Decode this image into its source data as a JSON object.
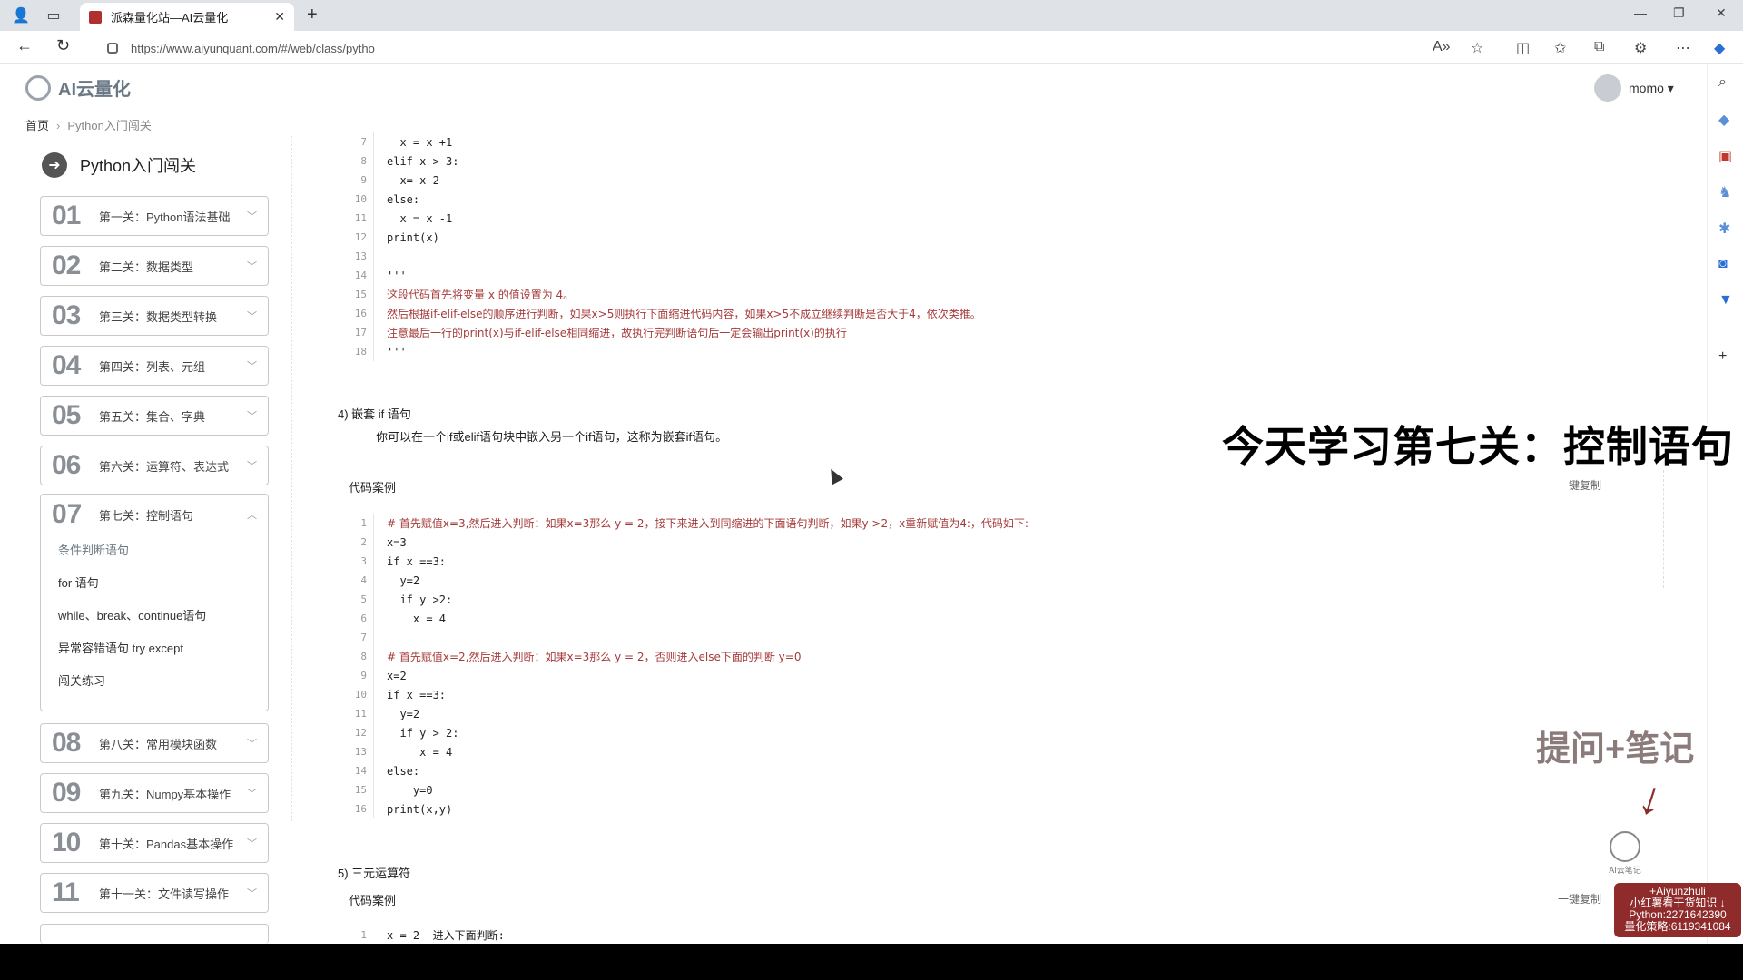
{
  "browser": {
    "tab_title": "派森量化站—AI云量化",
    "url": "https://www.aiyunquant.com/#/web/class/pytho",
    "colors": {
      "tabbar": "#dfe3e8",
      "accent": "#a63b3b"
    }
  },
  "site": {
    "logo_text": "AI云量化",
    "user_name": "momo ▾",
    "breadcrumb": {
      "home": "首页",
      "current": "Python入门闯关"
    }
  },
  "sidebar": {
    "course_title": "Python入门闯关",
    "lessons": [
      {
        "num": "01",
        "title": "第一关：Python语法基础"
      },
      {
        "num": "02",
        "title": "第二关：数据类型"
      },
      {
        "num": "03",
        "title": "第三关：数据类型转换"
      },
      {
        "num": "04",
        "title": "第四关：列表、元组"
      },
      {
        "num": "05",
        "title": "第五关：集合、字典"
      },
      {
        "num": "06",
        "title": "第六关：运算符、表达式"
      },
      {
        "num": "07",
        "title": "第七关：控制语句"
      },
      {
        "num": "08",
        "title": "第八关：常用模块函数"
      },
      {
        "num": "09",
        "title": "第九关：Numpy基本操作"
      },
      {
        "num": "10",
        "title": "第十关：Pandas基本操作"
      },
      {
        "num": "11",
        "title": "第十一关：文件读写操作"
      }
    ],
    "open_lesson_items": [
      "条件判断语句",
      "for 语句",
      "while、break、continue语句",
      "异常容错语句 try except",
      "闯关练习"
    ]
  },
  "main": {
    "code_top": [
      {
        "n": "7",
        "t": "  x = x +1"
      },
      {
        "n": "8",
        "t": "elif x > 3:"
      },
      {
        "n": "9",
        "t": "  x= x-2"
      },
      {
        "n": "10",
        "t": "else:"
      },
      {
        "n": "11",
        "t": "  x = x -1"
      },
      {
        "n": "12",
        "t": "print(x)"
      },
      {
        "n": "13",
        "t": ""
      },
      {
        "n": "14",
        "t": "'''"
      },
      {
        "n": "15",
        "t": "这段代码首先将变量 x 的值设置为 4。",
        "c": true
      },
      {
        "n": "16",
        "t": "然后根据if-elif-else的顺序进行判断，如果x>5则执行下面缩进代码内容，如果x>5不成立继续判断是否大于4，依次类推。",
        "c": true
      },
      {
        "n": "17",
        "t": "注意最后一行的print(x)与if-elif-else相同缩进，故执行完判断语句后一定会输出print(x)的执行",
        "c": true
      },
      {
        "n": "18",
        "t": "'''"
      }
    ],
    "section4_title": "4) 嵌套 if 语句",
    "section4_desc": "你可以在一个if或elif语句块中嵌入另一个if语句，这称为嵌套if语句。",
    "case_label": "代码案例",
    "copy_label": "一键复制",
    "code_nested": [
      {
        "n": "1",
        "t": "# 首先赋值x=3,然后进入判断：如果x=3那么 y = 2，接下来进入到同缩进的下面语句判断，如果y >2，x重新赋值为4:，代码如下:",
        "c": true
      },
      {
        "n": "2",
        "t": "x=3"
      },
      {
        "n": "3",
        "t": "if x ==3:"
      },
      {
        "n": "4",
        "t": "  y=2"
      },
      {
        "n": "5",
        "t": "  if y >2:"
      },
      {
        "n": "6",
        "t": "    x = 4"
      },
      {
        "n": "7",
        "t": ""
      },
      {
        "n": "8",
        "t": "# 首先赋值x=2,然后进入判断：如果x=3那么 y = 2，否则进入else下面的判断 y=0",
        "c": true
      },
      {
        "n": "9",
        "t": "x=2"
      },
      {
        "n": "10",
        "t": "if x ==3:"
      },
      {
        "n": "11",
        "t": "  y=2"
      },
      {
        "n": "12",
        "t": "  if y > 2:"
      },
      {
        "n": "13",
        "t": "     x = 4"
      },
      {
        "n": "14",
        "t": "else:"
      },
      {
        "n": "15",
        "t": "    y=0"
      },
      {
        "n": "16",
        "t": "print(x,y)"
      }
    ],
    "section5_title": "5) 三元运算符",
    "section5_case_label": "代码案例",
    "section5_copy_label": "一键复制",
    "code_ternary_first": {
      "n": "1",
      "t": "x = 2  进入下面判断:"
    }
  },
  "overlay": {
    "banner": "今天学习第七关：控制语句",
    "note": "提问+笔记",
    "ai_badge": "AI云笔记",
    "promo_lines": [
      "+Aiyunzhuli",
      "小红薯看干货知识 ↓",
      "Python:2271642390",
      "量化策略:6119341084"
    ]
  }
}
